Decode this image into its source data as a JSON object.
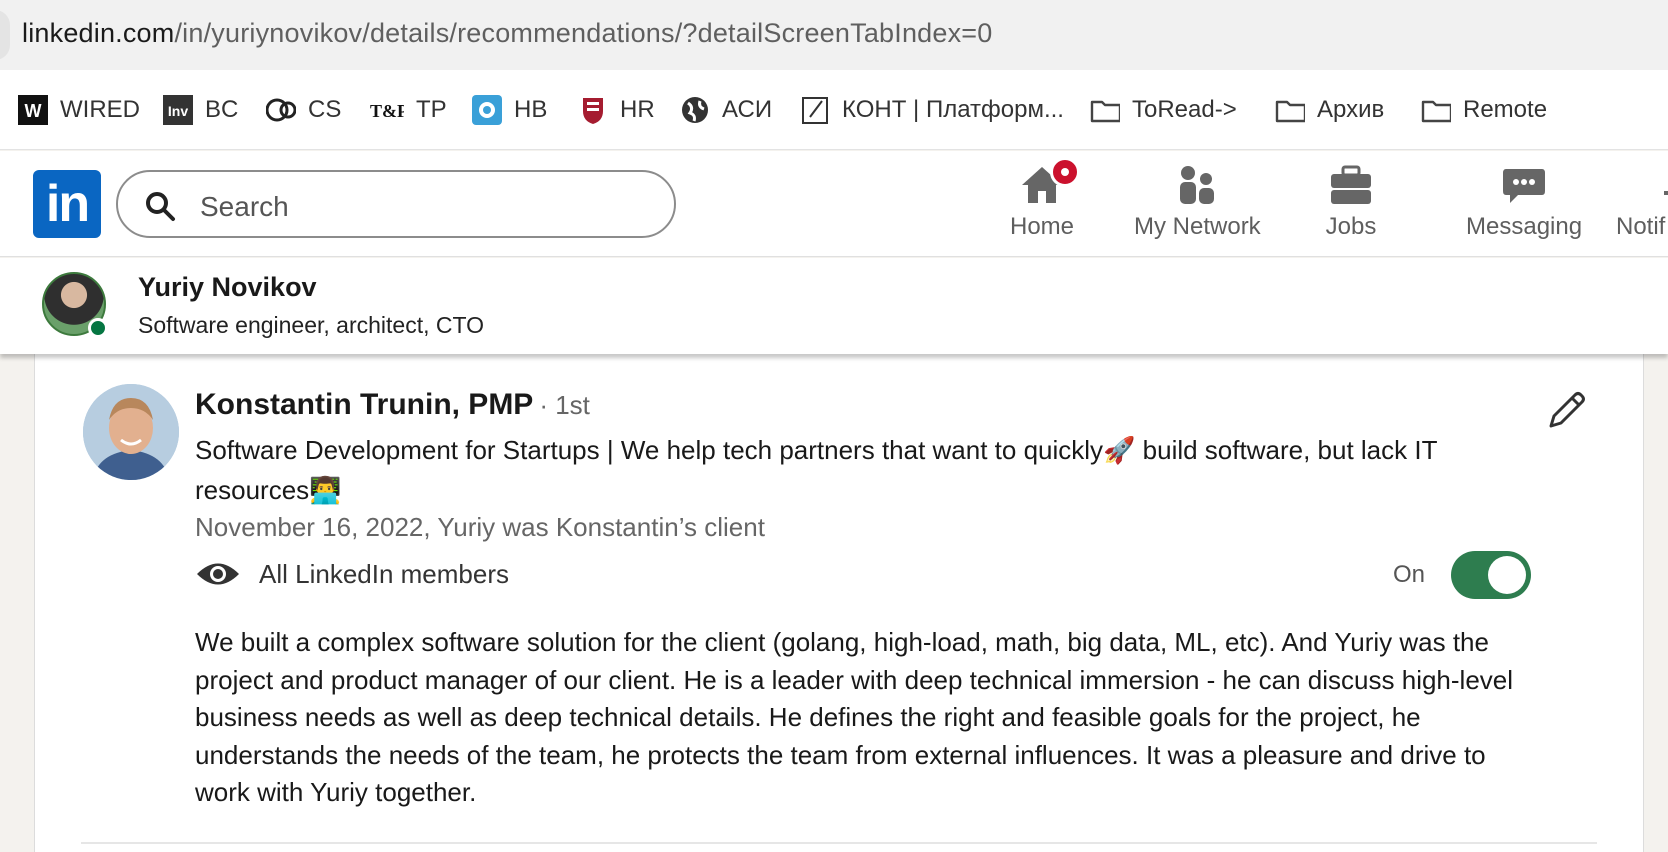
{
  "browser": {
    "url_host": "linkedin.com",
    "url_path": "/in/yuriynovikov/details/recommendations/?detailScreenTabIndex=0"
  },
  "bookmarks": [
    {
      "label": "WIRED",
      "icon": "wired-icon"
    },
    {
      "label": "BC",
      "icon": "inv-icon"
    },
    {
      "label": "CS",
      "icon": "cs-icon"
    },
    {
      "label": "TP",
      "icon": "tp-icon"
    },
    {
      "label": "HB",
      "icon": "hb-icon"
    },
    {
      "label": "HR",
      "icon": "hr-icon"
    },
    {
      "label": "АСИ",
      "icon": "globe-icon"
    },
    {
      "label": "КОНТ | Платформ...",
      "icon": "doc-icon"
    },
    {
      "label": "ToRead->",
      "icon": "folder-icon"
    },
    {
      "label": "Архив",
      "icon": "folder-icon"
    },
    {
      "label": "Remote",
      "icon": "folder-icon"
    }
  ],
  "linkedin_nav": {
    "logo": "in",
    "search_placeholder": "Search",
    "items": [
      {
        "label": "Home",
        "icon": "home-icon"
      },
      {
        "label": "My Network",
        "icon": "network-icon"
      },
      {
        "label": "Jobs",
        "icon": "briefcase-icon"
      },
      {
        "label": "Messaging",
        "icon": "messaging-icon"
      },
      {
        "label": "Notif",
        "icon": "bell-icon"
      }
    ]
  },
  "profile": {
    "name": "Yuriy Novikov",
    "headline": "Software engineer, architect, CTO"
  },
  "recommendation": {
    "name": "Konstantin Trunin, PMP",
    "degree": "· 1st",
    "headline": "Software Development for Startups | We help tech partners that want to quickly🚀 build software, but lack IT resources👨‍💻",
    "date_relation": "November 16, 2022, Yuriy was Konstantin’s client",
    "visibility": "All LinkedIn members",
    "toggle_label": "On",
    "toggle_on": true,
    "text": "We built a complex software solution for the client (golang, high-load, math, big data, ML, etc). And Yuriy was the project and product manager of our client. He is a leader with deep technical immersion - he can discuss high-level business needs as well as deep technical details. He defines the right and feasible goals for the project, he understands the needs of the team, he protects the team from external influences. It was a pleasure and drive to work with Yuriy together."
  },
  "colors": {
    "linkedin_blue": "#0a66c2",
    "toggle_green": "#2e7d4f",
    "badge_red": "#cb112d",
    "online_green": "#057642"
  }
}
